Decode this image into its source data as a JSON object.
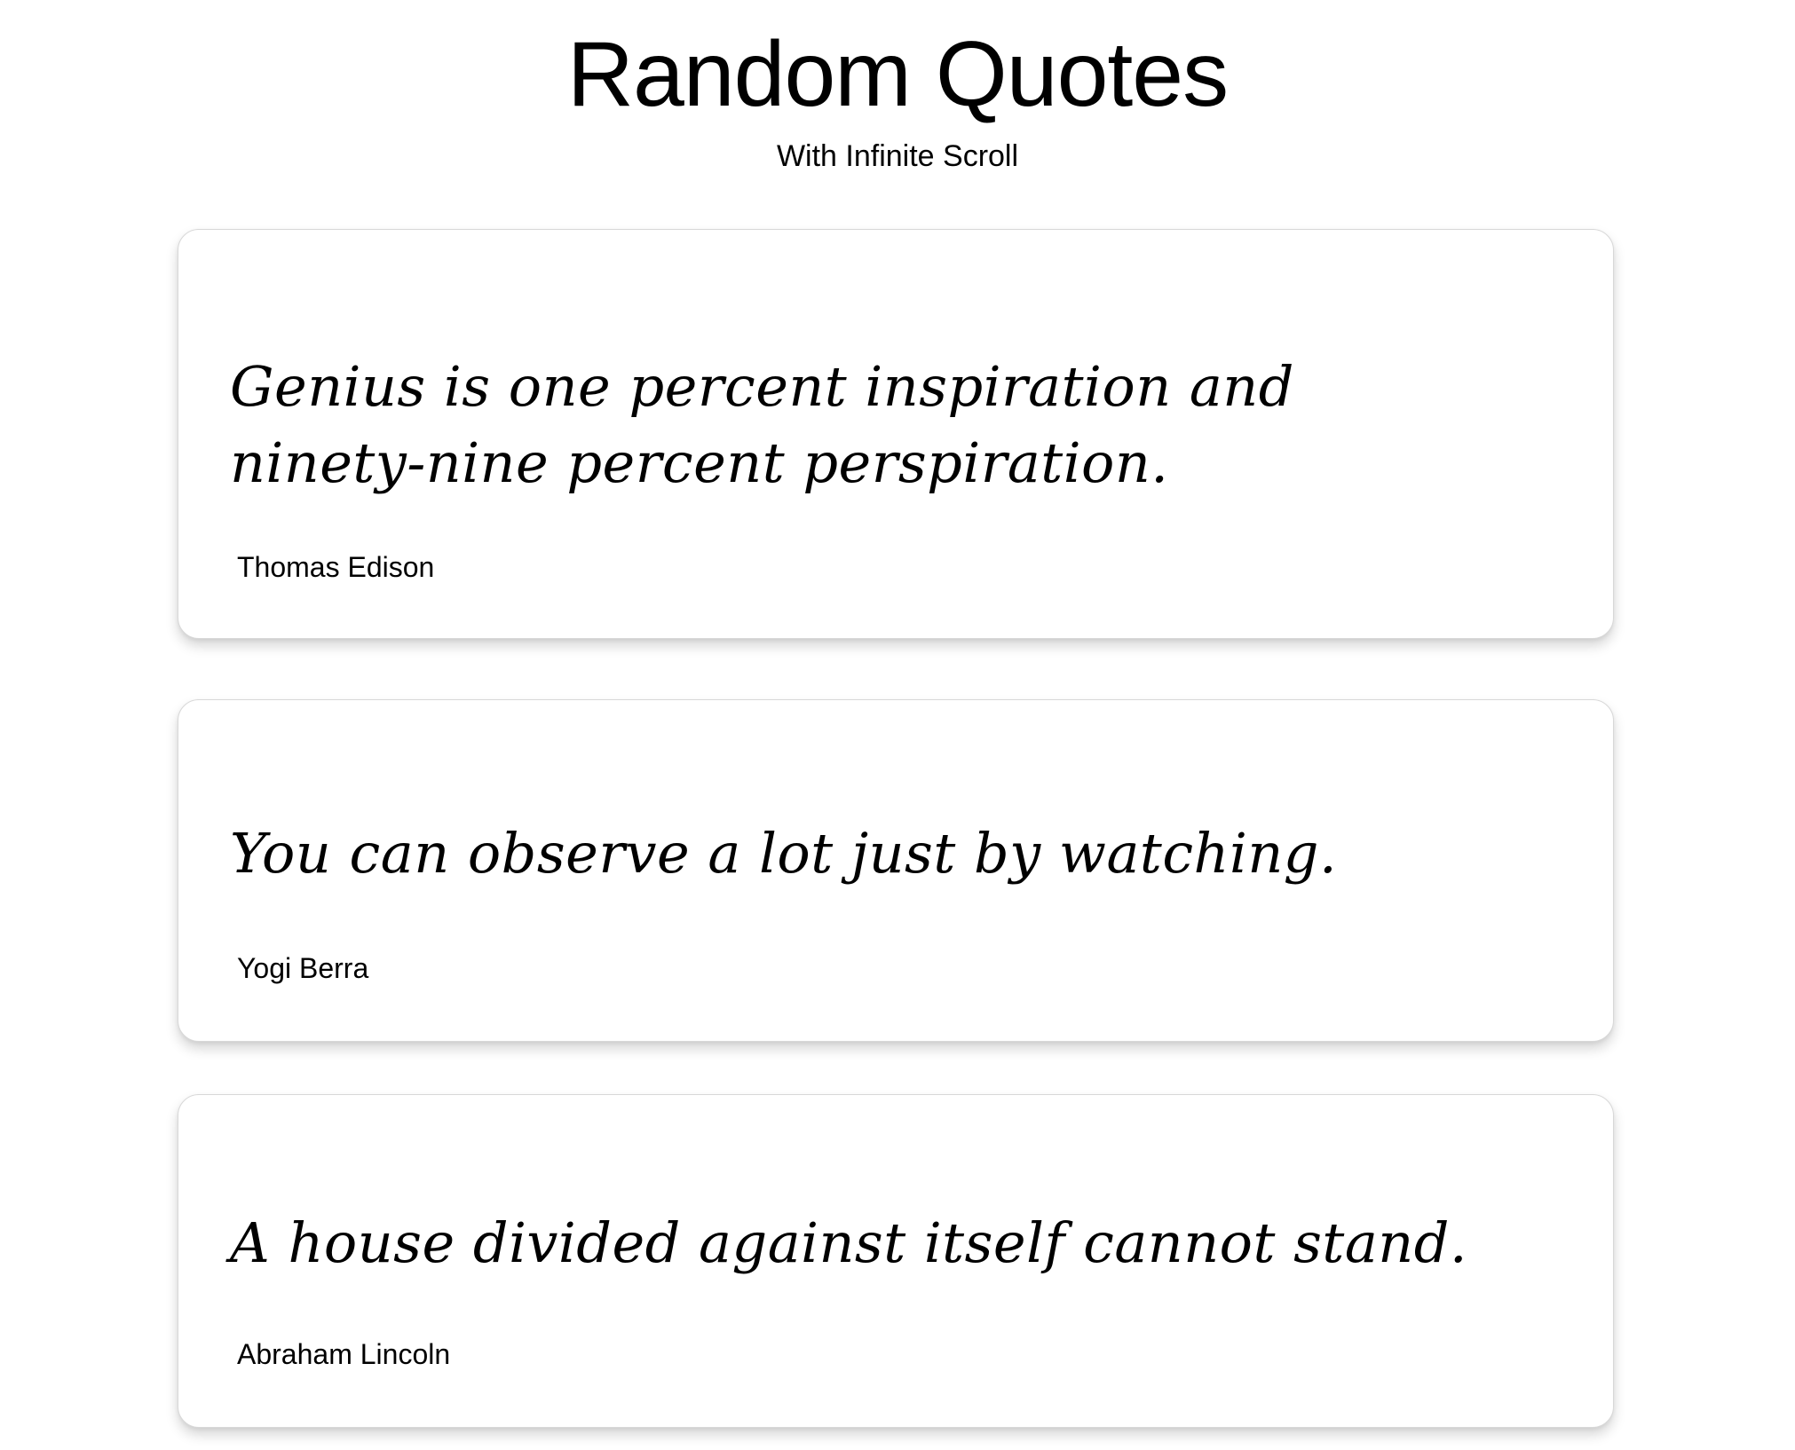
{
  "header": {
    "title": "Random Quotes",
    "subtitle": "With Infinite Scroll"
  },
  "quotes": [
    {
      "text": "Genius is one percent inspiration and ninety-nine percent perspiration.",
      "author": "Thomas Edison"
    },
    {
      "text": "You can observe a lot just by watching.",
      "author": "Yogi Berra"
    },
    {
      "text": "A house divided against itself cannot stand.",
      "author": "Abraham Lincoln"
    }
  ]
}
